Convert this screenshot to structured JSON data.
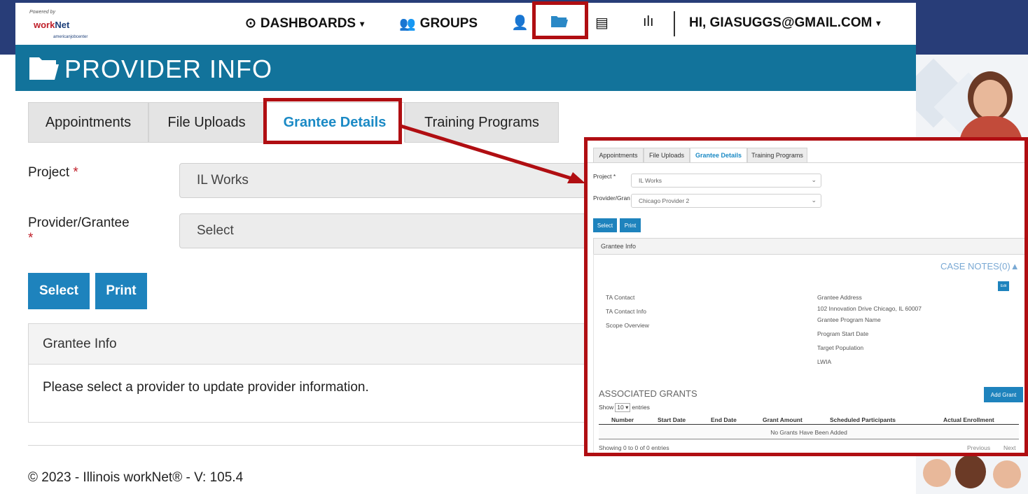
{
  "nav": {
    "logo": {
      "powered": "Powered by",
      "brand_prefix": "work",
      "brand_suffix": "Net",
      "sub": "americanjobcenter"
    },
    "dashboards": "DASHBOARDS",
    "groups": "GROUPS",
    "user": "HI, GIASUGGS@GMAIL.COM",
    "icons": [
      "clock-icon",
      "groups-icon",
      "person-icon",
      "folder-icon",
      "list-icon",
      "bar-chart-icon"
    ]
  },
  "header": {
    "title": "PROVIDER INFO"
  },
  "tabs": [
    {
      "label": "Appointments"
    },
    {
      "label": "File Uploads"
    },
    {
      "label": "Grantee Details",
      "active": true
    },
    {
      "label": "Training Programs"
    }
  ],
  "form": {
    "project_label": "Project",
    "project_value": "IL Works",
    "provider_label": "Provider/Grantee",
    "provider_value": "Select",
    "required_mark": "*",
    "select_button": "Select",
    "print_button": "Print"
  },
  "grantee_panel": {
    "title": "Grantee Info",
    "message": "Please select a provider to update provider information."
  },
  "footer": {
    "text": "© 2023 - Illinois workNet® - V: 105.4"
  },
  "inset": {
    "tabs": [
      "Appointments",
      "File Uploads",
      "Grantee Details",
      "Training Programs"
    ],
    "project_label": "Project *",
    "project_value": "IL Works",
    "provider_label": "Provider/Gran",
    "provider_value": "Chicago Provider 2",
    "select_button": "Select",
    "print_button": "Print",
    "grantee_info": "Grantee Info",
    "case_notes": "CASE NOTES(0)",
    "edit_button": "Edit",
    "left_fields": [
      "TA Contact",
      "TA Contact Info",
      "Scope Overview"
    ],
    "right_fields": [
      "Grantee Address",
      "102 Innovation Drive Chicago, IL 60007",
      "Grantee Program Name",
      "Program Start Date",
      "Target Population",
      "LWIA"
    ],
    "associated_grants": "ASSOCIATED GRANTS",
    "add_grant": "Add Grant",
    "show_prefix": "Show",
    "show_value": "10",
    "show_suffix": "entries",
    "columns": [
      "Number",
      "Start Date",
      "End Date",
      "Grant Amount",
      "Scheduled Participants",
      "Actual Enrollment"
    ],
    "empty_message": "No Grants Have Been Added",
    "info": "Showing 0 to 0 of 0 entries",
    "previous": "Previous",
    "next": "Next"
  },
  "colors": {
    "accent": "#12739b",
    "highlight": "#b00e12",
    "button": "#1e83bd",
    "band": "#283d78"
  }
}
